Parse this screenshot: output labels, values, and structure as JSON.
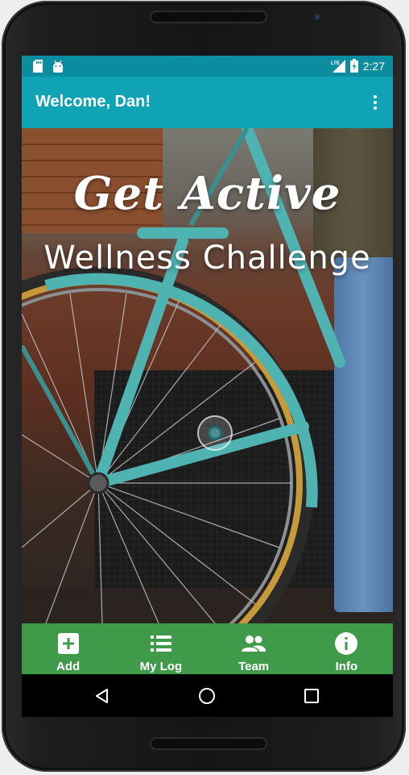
{
  "status_bar": {
    "left_icons": [
      "sd-card-icon",
      "android-icon"
    ],
    "right_icons": [
      "lte-signal-icon",
      "battery-icon"
    ],
    "lte_label": "LTE",
    "time": "2:27"
  },
  "app_bar": {
    "title": "Welcome, Dan!",
    "overflow_icon": "more-vert-icon"
  },
  "hero": {
    "title": "Get Active",
    "subtitle": "Wellness Challenge"
  },
  "bottom_nav": {
    "items": [
      {
        "label": "Add",
        "icon": "add-box-icon"
      },
      {
        "label": "My Log",
        "icon": "list-icon"
      },
      {
        "label": "Team",
        "icon": "group-icon"
      },
      {
        "label": "Info",
        "icon": "info-icon"
      }
    ]
  },
  "system_nav": {
    "buttons": [
      "back-icon",
      "home-icon",
      "recents-icon"
    ]
  },
  "colors": {
    "status_bar": "#0b8c9f",
    "app_bar": "#0fa3b5",
    "bottom_nav": "#3f9a4a",
    "text": "#ffffff"
  }
}
